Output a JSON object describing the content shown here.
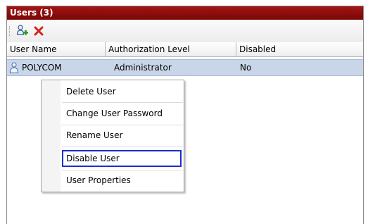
{
  "panel": {
    "title": "Users (3)"
  },
  "toolbar": {
    "add_icon": "add-user-icon",
    "delete_icon": "delete-x-icon"
  },
  "table": {
    "columns": [
      "User Name",
      "Authorization Level",
      "Disabled"
    ],
    "rows": [
      {
        "user_name": "POLYCOM",
        "authorization_level": "Administrator",
        "disabled": "No",
        "icon": "user-icon"
      }
    ]
  },
  "context_menu": {
    "items": [
      {
        "label": "Delete User"
      },
      {
        "label": "Change User Password"
      },
      {
        "label": "Rename User"
      },
      {
        "label": "Disable User"
      },
      {
        "label": "User Properties"
      }
    ],
    "highlighted_item": "Disable User"
  },
  "colors": {
    "title_bar": "#8a0b0b",
    "selected_row": "#c9d6ea",
    "highlight_border": "#1d2fc9"
  }
}
